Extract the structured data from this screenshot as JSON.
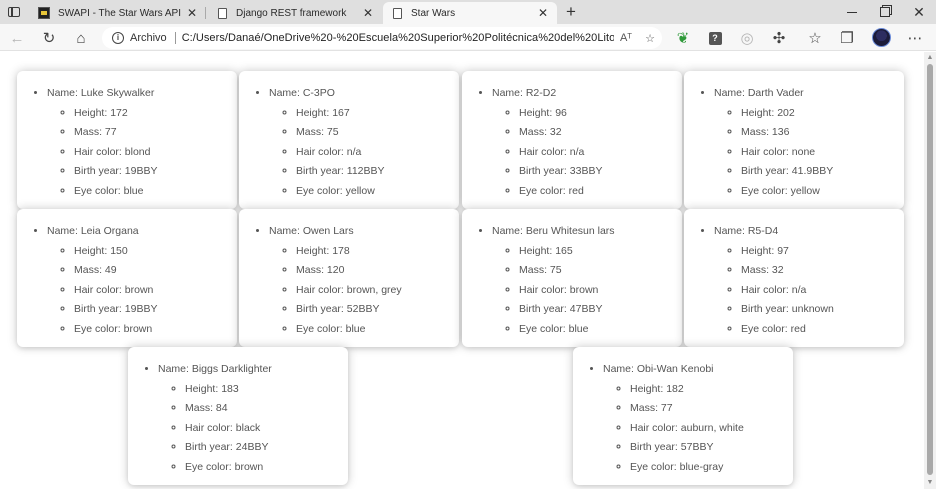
{
  "tabs": [
    {
      "title": "SWAPI - The Star Wars API",
      "favicon": "swapi-icon",
      "active": false
    },
    {
      "title": "Django REST framework",
      "favicon": "page-icon",
      "active": false
    },
    {
      "title": "Star Wars",
      "favicon": "page-icon",
      "active": true
    }
  ],
  "toolbar": {
    "address_label": "Archivo",
    "url": "C:/Users/Danaé/OneDrive%20-%20Escuela%20Superior%20Politécnica%20del%20Litoral/5...",
    "read_aloud_label": "Aᵀ"
  },
  "labels": {
    "name": "Name: ",
    "height": "Height: ",
    "mass": "Mass: ",
    "hair": "Hair color: ",
    "birth": "Birth year: ",
    "eye": "Eye color: "
  },
  "characters": [
    {
      "name": "Luke Skywalker",
      "height": "172",
      "mass": "77",
      "hair_color": "blond",
      "birth_year": "19BBY",
      "eye_color": "blue"
    },
    {
      "name": "C-3PO",
      "height": "167",
      "mass": "75",
      "hair_color": "n/a",
      "birth_year": "112BBY",
      "eye_color": "yellow"
    },
    {
      "name": "R2-D2",
      "height": "96",
      "mass": "32",
      "hair_color": "n/a",
      "birth_year": "33BBY",
      "eye_color": "red"
    },
    {
      "name": "Darth Vader",
      "height": "202",
      "mass": "136",
      "hair_color": "none",
      "birth_year": "41.9BBY",
      "eye_color": "yellow"
    },
    {
      "name": "Leia Organa",
      "height": "150",
      "mass": "49",
      "hair_color": "brown",
      "birth_year": "19BBY",
      "eye_color": "brown"
    },
    {
      "name": "Owen Lars",
      "height": "178",
      "mass": "120",
      "hair_color": "brown, grey",
      "birth_year": "52BBY",
      "eye_color": "blue"
    },
    {
      "name": "Beru Whitesun lars",
      "height": "165",
      "mass": "75",
      "hair_color": "brown",
      "birth_year": "47BBY",
      "eye_color": "blue"
    },
    {
      "name": "R5-D4",
      "height": "97",
      "mass": "32",
      "hair_color": "n/a",
      "birth_year": "unknown",
      "eye_color": "red"
    },
    {
      "name": "Biggs Darklighter",
      "height": "183",
      "mass": "84",
      "hair_color": "black",
      "birth_year": "24BBY",
      "eye_color": "brown"
    },
    {
      "name": "Obi-Wan Kenobi",
      "height": "182",
      "mass": "77",
      "hair_color": "auburn, white",
      "birth_year": "57BBY",
      "eye_color": "blue-gray"
    }
  ]
}
